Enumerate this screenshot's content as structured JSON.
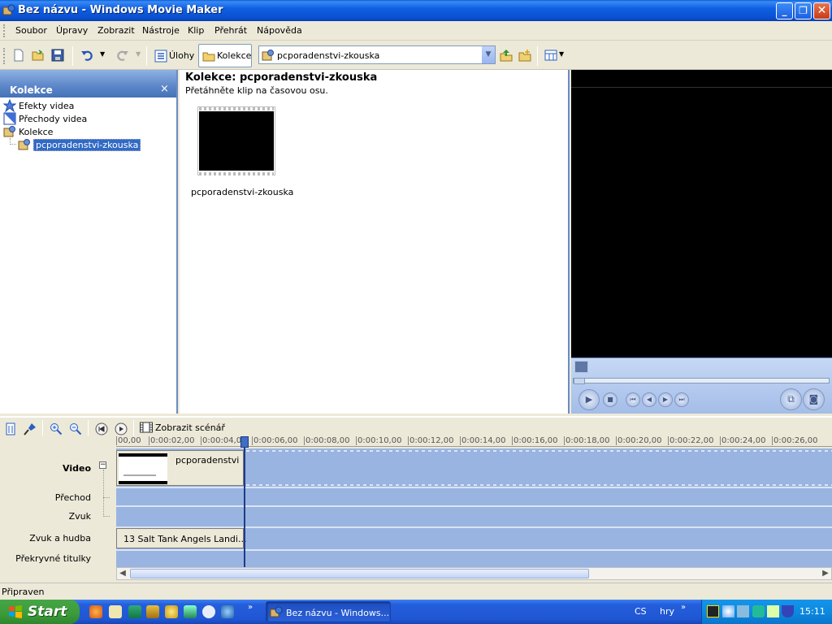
{
  "window": {
    "title": "Bez názvu - Windows Movie Maker",
    "min": "_",
    "max": "❐",
    "close": "✕"
  },
  "menu": [
    "Soubor",
    "Úpravy",
    "Zobrazit",
    "Nástroje",
    "Klip",
    "Přehrát",
    "Nápověda"
  ],
  "toolbar": {
    "tasks_label": "Úlohy",
    "collections_label": "Kolekce",
    "collection_value": "pcporadenstvi-zkouska"
  },
  "left_pane": {
    "title": "Kolekce",
    "close": "×",
    "items": [
      "Efekty videa",
      "Přechody videa",
      "Kolekce",
      "pcporadenstvi-zkouska"
    ]
  },
  "center_pane": {
    "title": "Kolekce: pcporadenstvi-zkouska",
    "hint": "Přetáhněte klip na časovou osu.",
    "clip_name": "pcporadenstvi-zkouska"
  },
  "timeline_toolbar": {
    "storyboard_label": "Zobrazit scénář"
  },
  "ruler_ticks": [
    "00,00",
    "0:00:02,00",
    "0:00:04,00",
    "0:00:06,00",
    "0:00:08,00",
    "0:00:10,00",
    "0:00:12,00",
    "0:00:14,00",
    "0:00:16,00",
    "0:00:18,00",
    "0:00:20,00",
    "0:00:22,00",
    "0:00:24,00",
    "0:00:26,00"
  ],
  "tracks": {
    "video": "Video",
    "transition": "Přechod",
    "audio": "Zvuk",
    "audio_music": "Zvuk a hudba",
    "titles": "Překryvné titulky"
  },
  "clips": {
    "video_clip": "pcporadenstvi",
    "audio_clip": "13 Salt Tank  Angels Landi..."
  },
  "status": "Připraven",
  "taskbar": {
    "start": "Start",
    "task_button": "Bez názvu - Windows...",
    "lang": "CS",
    "toolbar_name": "hry",
    "clock": "15:11",
    "more": "»"
  }
}
